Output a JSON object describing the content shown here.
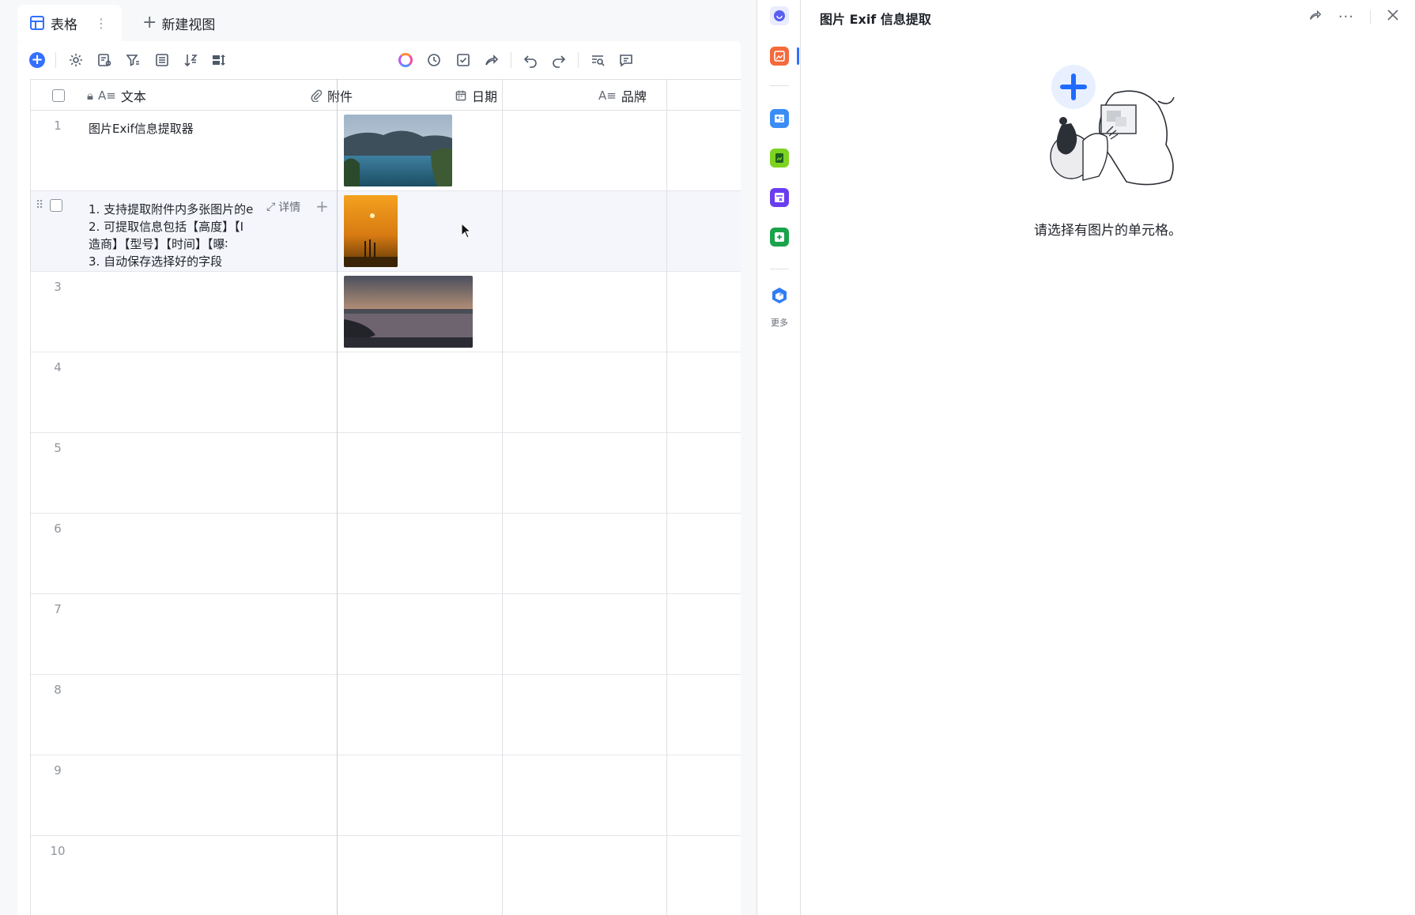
{
  "tabs": {
    "active_label": "表格",
    "new_view_label": "新建视图"
  },
  "columns": [
    {
      "label": "文本",
      "icon": "text-field-icon",
      "locked": true
    },
    {
      "label": "附件",
      "icon": "paperclip-icon"
    },
    {
      "label": "日期",
      "icon": "calendar-icon"
    },
    {
      "label": "品牌",
      "icon": "text-field-icon"
    }
  ],
  "rows": [
    {
      "num": "1",
      "text": "图片Exif信息提取器",
      "attachment": "lake-mountain-photo"
    },
    {
      "num": "",
      "lines": [
        "1. 支持提取附件内多张图片的e",
        "2. 可提取信息包括【高度】【I",
        "造商】【型号】【时间】【曝∶",
        "3. 自动保存选择好的字段"
      ],
      "attachment": "sunset-photo",
      "detail_label": "详情"
    },
    {
      "num": "3",
      "text": "",
      "attachment": "city-dusk-photo"
    },
    {
      "num": "4"
    },
    {
      "num": "5"
    },
    {
      "num": "6"
    },
    {
      "num": "7"
    },
    {
      "num": "8"
    },
    {
      "num": "9"
    },
    {
      "num": "10"
    }
  ],
  "rail": {
    "more_label": "更多"
  },
  "panel": {
    "title": "图片 Exif 信息提取",
    "empty_message": "请选择有图片的单元格。"
  },
  "colors": {
    "accent": "#3370ff",
    "border": "#dee0e3"
  }
}
